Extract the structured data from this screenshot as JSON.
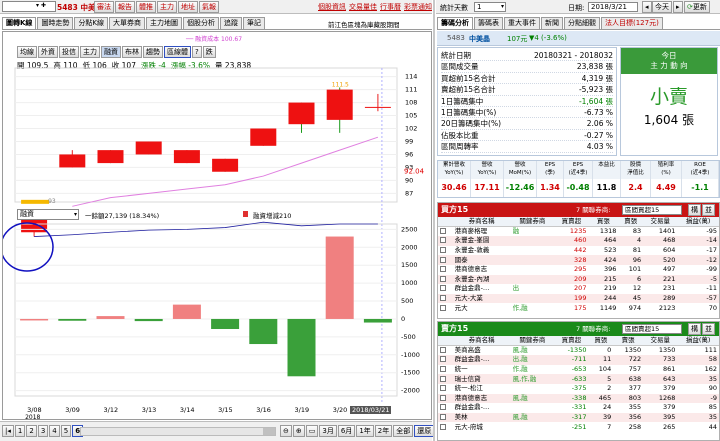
{
  "toolbar": {
    "stock_selector": "5483 中美晶",
    "left_buttons": [
      "審法",
      "報告",
      "體推",
      "主力",
      "地址",
      "氣報"
    ],
    "links": [
      "個股資訊",
      "交易量佳",
      "行事曆",
      "彩票通知"
    ]
  },
  "chart_tabs": [
    "圖轉K線",
    "圖時走勢",
    "分點K線",
    "大單券商",
    "主力地圖",
    "個股分析",
    "追蹤",
    "筆記"
  ],
  "chart_note": "前江色區塊為庫藏股期間",
  "indicator_buttons": [
    "均線",
    "外資",
    "投信",
    "主力",
    "融資",
    "布林",
    "趨勢",
    "區線體",
    "?",
    "跌"
  ],
  "ohlc": {
    "open": "開 109.5",
    "high": "高 110",
    "low": "低 106",
    "close": "收 107",
    "change": "漲跌 -4",
    "pct": "漲幅 -3.6%",
    "volume": "量 23,838"
  },
  "ma_legend": "融資成本 100.67",
  "indicator2_select": "融資",
  "indicator2_legend": {
    "a": "一餘額27,139 (18.34%)",
    "b": "融資增減210"
  },
  "price_tag_right": "92.04",
  "price_max_label": "111.5",
  "price_low_label": "93",
  "x_year": "2018",
  "x_selected_date": "2018/03/21",
  "chart_data": {
    "type": "candlestick",
    "dates": [
      "3/08",
      "3/09",
      "3/12",
      "3/13",
      "3/14",
      "3/15",
      "3/16",
      "3/19",
      "3/20",
      "3/21"
    ],
    "price": {
      "open": [
        78,
        93,
        97,
        99,
        94,
        95,
        98,
        108,
        111,
        107
      ],
      "close": [
        83,
        96,
        94,
        96,
        97,
        92,
        102,
        103,
        104,
        107
      ],
      "high": [
        83,
        97,
        97,
        99,
        97,
        95,
        102,
        108,
        111.5,
        110
      ],
      "low": [
        77,
        93,
        94,
        96,
        94,
        92,
        98,
        101,
        101,
        106
      ],
      "yaxis_ticks": [
        87,
        90,
        93,
        96,
        99,
        102,
        105,
        108,
        111,
        114
      ],
      "ma_line": [
        0,
        84,
        86,
        87,
        88,
        89,
        91,
        94,
        97,
        100
      ]
    },
    "margin_change": {
      "values": [
        0,
        -50,
        80,
        -60,
        400,
        -280,
        -700,
        -1600,
        2300,
        -100
      ],
      "yaxis_ticks": [
        2500,
        2000,
        1500,
        1000,
        500,
        0,
        -500,
        -1000,
        -1500,
        -2000
      ]
    },
    "margin_balance_line": [
      2300,
      2350,
      2420,
      2480,
      2500,
      2550,
      2700,
      2600,
      2650,
      2650
    ]
  },
  "bottom_nav": {
    "pages": [
      "1",
      "2",
      "3",
      "4",
      "5",
      "6"
    ],
    "ranges": [
      "3月",
      "6月",
      "1年",
      "2年",
      "全部",
      "還原"
    ]
  },
  "right_header": {
    "range_label": "統計天數",
    "range_value": "1",
    "date_label": "日期:",
    "date_value": "2018/3/21",
    "today": "今天",
    "refresh": "更新"
  },
  "right_tabs": [
    "籌碼分析",
    "籌碼表",
    "重大事件",
    "新聞",
    "分點細觀",
    "法人目標(127元)"
  ],
  "stock_line": {
    "code": "5483",
    "name": "中美晶",
    "price": "107元",
    "change": "▼4 (-3.6%)"
  },
  "chip_stats": [
    {
      "label": "統計日期",
      "value": "20180321 - 2018032"
    },
    {
      "label": "區間成交量",
      "value": "23,838 張"
    },
    {
      "label": "買超前15名合計",
      "value": "4,319 張"
    },
    {
      "label": "賣超前15名合計",
      "value": "-5,923 張"
    },
    {
      "label": "1日籌碼集中",
      "value": "-1,604 張"
    },
    {
      "label": "1日籌碼集中(%)",
      "value": "-6.73 %"
    },
    {
      "label": "20日籌碼集中(%)",
      "value": "2.06 %"
    },
    {
      "label": "佔股本比重",
      "value": "-0.27 %"
    },
    {
      "label": "區間周轉率",
      "value": "4.03 %"
    }
  ],
  "today_box": {
    "title": "今日",
    "subtitle": "主 力 動 向",
    "verdict": "小賣",
    "amount": "1,604 張"
  },
  "fundamentals": {
    "headers": [
      "累計營收\nYoY(%)",
      "營收\nYoY(%)",
      "營收\nMoM(%)",
      "EPS\n(季)",
      "EPS\n(近4季)",
      "本益比",
      "股價\n淨值比",
      "殖利率\n(%)",
      "ROE\n(近4季)"
    ],
    "values": [
      "30.46",
      "17.11",
      "-12.46",
      "1.34",
      "-0.48",
      "11.8",
      "2.4",
      "4.49",
      "-1.1"
    ]
  },
  "buy_panel": {
    "title": "買方15",
    "filter_label": "7 關聯券商:",
    "filter_value": "區間買超15",
    "btn1": "構",
    "btn2": "並",
    "headers": [
      "券商名稱",
      "關鍵券商",
      "買賣超",
      "買張",
      "賣張",
      "交易量",
      "損益(萬)"
    ],
    "rows": [
      [
        "港商麥格理",
        "融",
        "1235",
        "1318",
        "83",
        "1401",
        "-95"
      ],
      [
        "永豐金-峯園",
        "",
        "460",
        "464",
        "4",
        "468",
        "-14"
      ],
      [
        "永豐金-敦義",
        "",
        "442",
        "523",
        "81",
        "604",
        "-17"
      ],
      [
        "國泰",
        "",
        "328",
        "424",
        "96",
        "520",
        "-12"
      ],
      [
        "港商德意志",
        "",
        "295",
        "396",
        "101",
        "497",
        "-99"
      ],
      [
        "永豐金-內湖",
        "",
        "209",
        "215",
        "6",
        "221",
        "-5"
      ],
      [
        "群益金鼎-…",
        "出",
        "207",
        "219",
        "12",
        "231",
        "-11"
      ],
      [
        "元大-大業",
        "",
        "199",
        "244",
        "45",
        "289",
        "-57"
      ],
      [
        "元大",
        "作,融",
        "175",
        "1149",
        "974",
        "2123",
        "70"
      ]
    ]
  },
  "sell_panel": {
    "title": "賣方15",
    "filter_label": "7 關聯券商:",
    "filter_value": "區間賣超15",
    "btn1": "構",
    "btn2": "並",
    "headers": [
      "券商名稱",
      "關鍵券商",
      "買賣超",
      "買張",
      "賣張",
      "交易量",
      "損益(萬)"
    ],
    "rows": [
      [
        "美商高盛",
        "風,融",
        "-1350",
        "0",
        "1350",
        "1350",
        "111"
      ],
      [
        "群益金鼎-…",
        "出,融",
        "-711",
        "11",
        "722",
        "733",
        "58"
      ],
      [
        "統一",
        "作,融",
        "-653",
        "104",
        "757",
        "861",
        "162"
      ],
      [
        "瑞士信貸",
        "風,作,融",
        "-633",
        "5",
        "638",
        "643",
        "35"
      ],
      [
        "統一-松江",
        "",
        "-375",
        "2",
        "377",
        "379",
        "90"
      ],
      [
        "港商德意志",
        "風,融",
        "-338",
        "465",
        "803",
        "1268",
        "-9"
      ],
      [
        "群益金鼎-…",
        "",
        "-331",
        "24",
        "355",
        "379",
        "85"
      ],
      [
        "美林",
        "風,融",
        "-317",
        "39",
        "356",
        "395",
        "35"
      ],
      [
        "元大-府城",
        "",
        "-251",
        "7",
        "258",
        "265",
        "44"
      ]
    ]
  }
}
